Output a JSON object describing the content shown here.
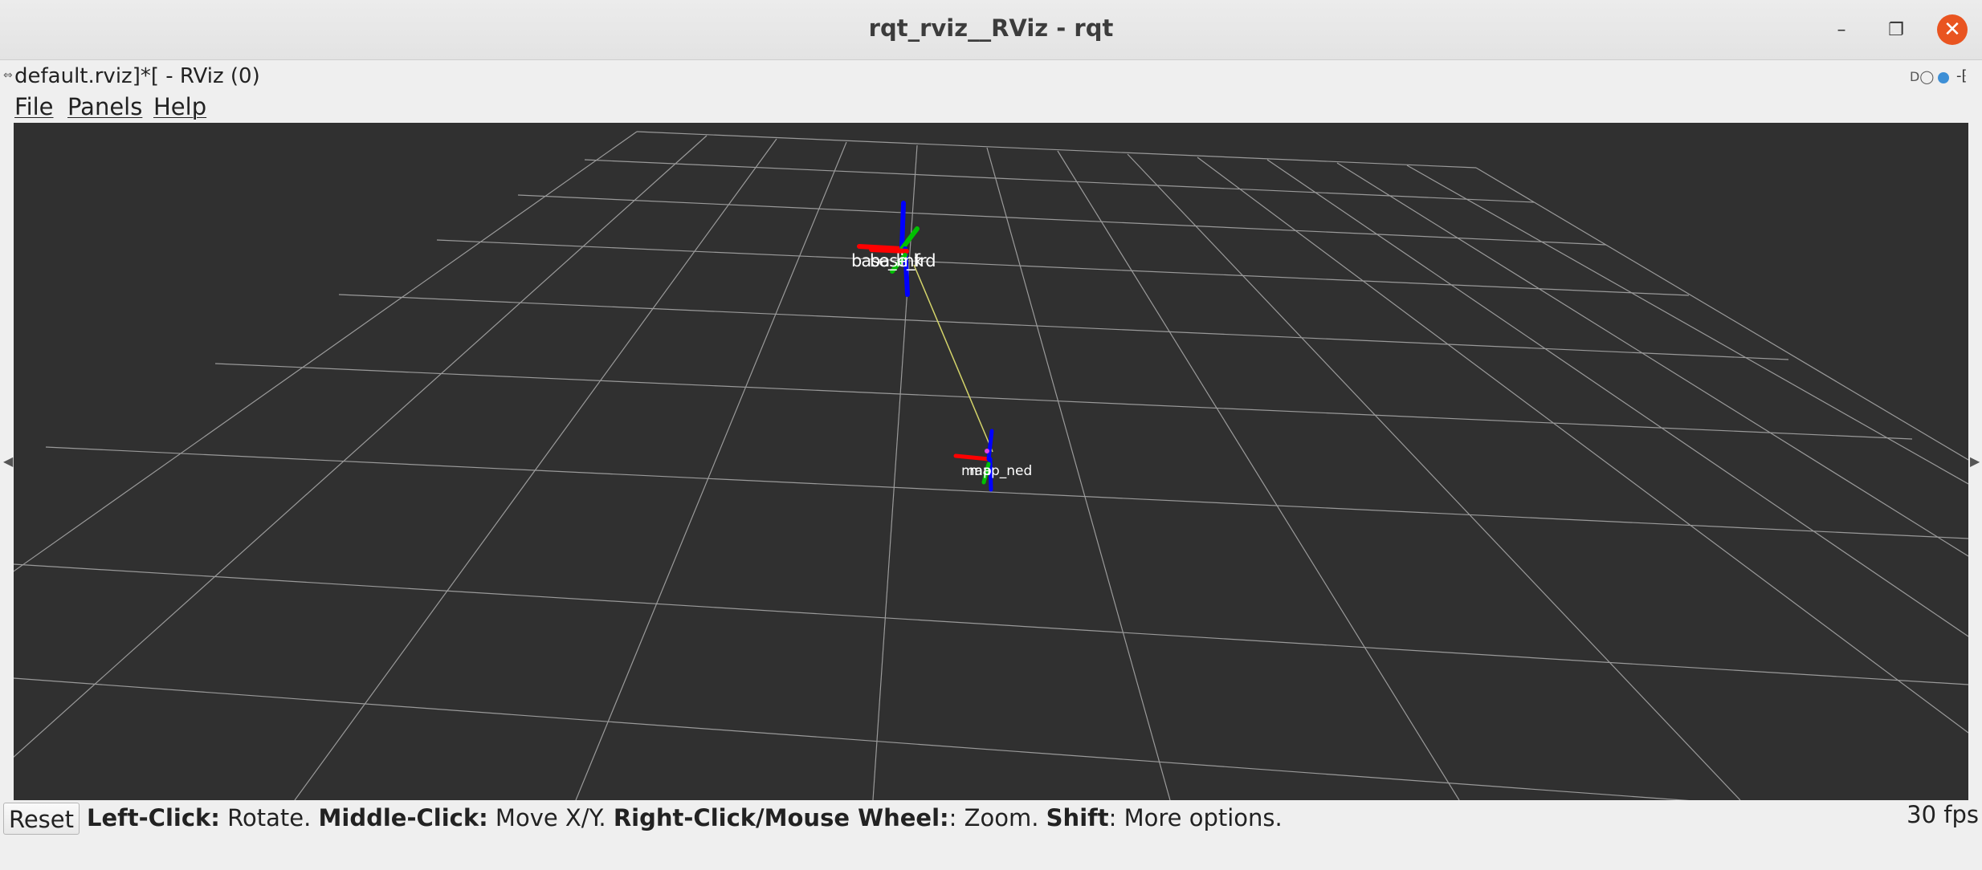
{
  "window": {
    "title": "rqt_rviz__RViz - rqt",
    "minimize_symbol": "–",
    "maximize_symbol": "❐",
    "close_symbol": "✕"
  },
  "plugin": {
    "subtitle": "default.rviz]*[ - RViz (0)",
    "left_mark": "⇔",
    "dock_icons": "D◯",
    "dock_right": "-⁅"
  },
  "menu": {
    "items": [
      "File",
      "Panels",
      "Help"
    ]
  },
  "viewport": {
    "background": "#303030",
    "grid_color": "#a0a0a0",
    "frames": [
      {
        "label_a": "base_link",
        "label_b": "base_frd"
      },
      {
        "label_a": "map",
        "label_b": "map_ned"
      }
    ],
    "tf_link_color": "#d4d46a",
    "axis_colors": {
      "x": "#ff0000",
      "y": "#00c000",
      "z": "#0000ff"
    }
  },
  "status": {
    "reset_label": "Reset",
    "hints": [
      {
        "key": "Left-Click:",
        "text": " Rotate. "
      },
      {
        "key": "Middle-Click:",
        "text": " Move X/Y. "
      },
      {
        "key": "Right-Click/Mouse Wheel:",
        "text": ": Zoom. "
      },
      {
        "key": "Shift",
        "text": ": More options."
      }
    ],
    "fps": "30 fps"
  }
}
